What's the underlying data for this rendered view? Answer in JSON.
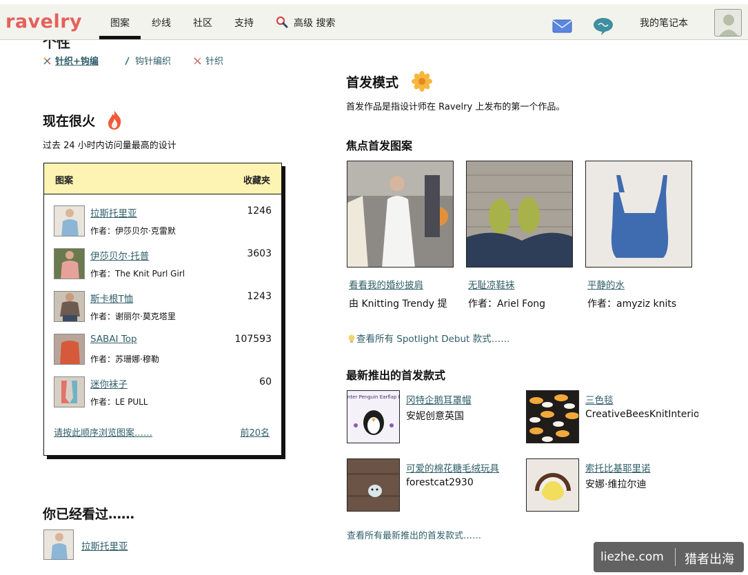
{
  "brand": {
    "logo": "ravelry",
    "accent": "#e5615a",
    "link_color": "#2f5e69"
  },
  "nav": {
    "tabs": [
      {
        "label": "图案",
        "active": true
      },
      {
        "label": "纱线"
      },
      {
        "label": "社区"
      },
      {
        "label": "支持"
      }
    ],
    "search_label": "高级 搜索",
    "notebook": "我的笔记本",
    "icons": [
      "search-icon",
      "mail-icon",
      "chat-icon",
      "avatar"
    ]
  },
  "left": {
    "cut_heading": "个性",
    "craft_links": [
      "针织+钩编",
      "钩针编织",
      "针织"
    ],
    "hot": {
      "title": "现在很火",
      "subtitle": "过去 24 小时内访问量最高的设计",
      "col_pattern": "图案",
      "col_favorites": "收藏夹",
      "rows": [
        {
          "name": "拉斯托里亚",
          "by": "作者：伊莎贝尔·克雷默",
          "count": "1246"
        },
        {
          "name": "伊莎贝尔·托普",
          "by": "作者：The Knit Purl Girl",
          "count": "3603"
        },
        {
          "name": "斯卡根T恤",
          "by": "作者：谢丽尔·莫克塔里",
          "count": "1243"
        },
        {
          "name": "SABAI Top",
          "by": "作者：苏珊娜·穆勒",
          "count": "107593"
        },
        {
          "name": "迷你袜子",
          "by": "作者：LE PULL",
          "count": "60"
        }
      ],
      "browse_link": "请按此顺序浏览图案……",
      "top20_link": "前20名"
    },
    "seen": {
      "title": "你已经看过……",
      "item": "拉斯托里亚"
    }
  },
  "right": {
    "debut_title": "首发模式",
    "debut_desc": "首发作品是指设计师在 Ravelry 上发布的第一个作品。",
    "spotlight_title": "焦点首发图案",
    "spotlight": [
      {
        "name": "看看我的婚纱披肩",
        "by": "由 Knitting Trendy 提"
      },
      {
        "name": "无耻凉鞋袜",
        "by": "作者：Ariel Fong"
      },
      {
        "name": "平静的水",
        "by": "作者：amyziz knits"
      }
    ],
    "spotlight_all": "查看所有 Spotlight Debut 款式……",
    "newest_title": "最新推出的首发款式",
    "newest": [
      {
        "name": "冈特企鹅耳罩帽",
        "by": "安妮创意英国",
        "thumb_caption": "Gunter Penguin Earflap Hat"
      },
      {
        "name": "三色毯",
        "by": "CreativeBeesKnitInteriors"
      },
      {
        "name": "可爱的棉花糖毛绒玩具",
        "by": "forestcat2930"
      },
      {
        "name": "索托比基耶里诺",
        "by": "安娜·维拉尔迪"
      }
    ],
    "newest_all": "查看所有最新推出的首发款式……"
  },
  "watermark": {
    "left": "liezhe.com",
    "right": "猎者出海"
  }
}
